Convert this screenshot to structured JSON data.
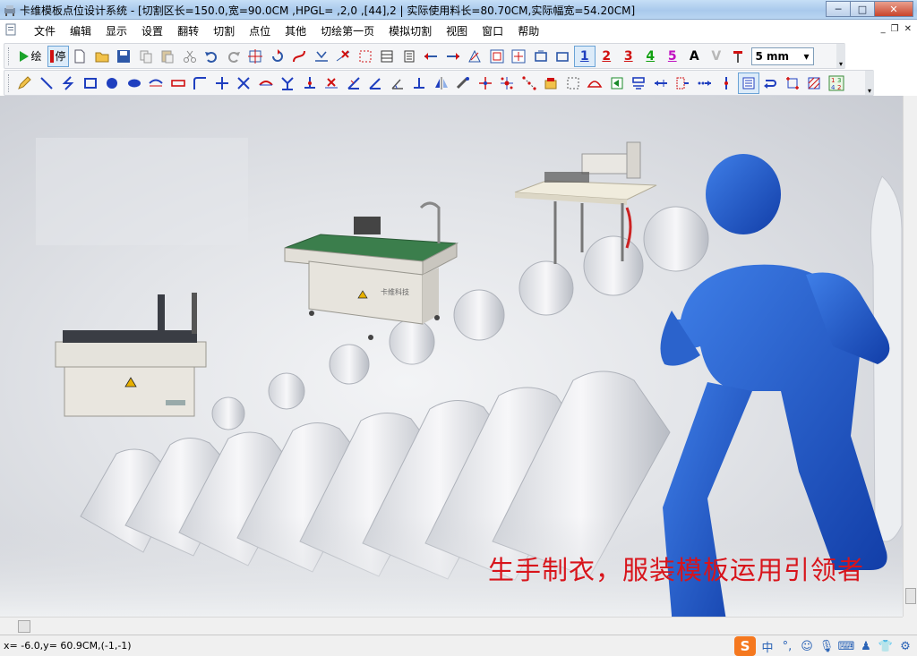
{
  "window": {
    "title": "卡维模板点位设计系统 - [切割区长=150.0,宽=90.0CM ,HPGL= ,2,0 ,[44],2 | 实际使用料长=80.70CM,实际幅宽=54.20CM]",
    "minimize": "─",
    "maximize": "□",
    "close": "✕"
  },
  "menu": {
    "items": [
      "文件",
      "编辑",
      "显示",
      "设置",
      "翻转",
      "切割",
      "点位",
      "其他",
      "切绘第一页",
      "模拟切割",
      "视图",
      "窗口",
      "帮助"
    ],
    "mdi_minimize": "_",
    "mdi_restore": "❐",
    "mdi_close": "✕"
  },
  "toolbar1": {
    "draw_label": "绘",
    "stop_label": "停",
    "layer_labels": [
      "1",
      "2",
      "3",
      "4",
      "5"
    ],
    "layer_colors": [
      "#1f3fbf",
      "#d01010",
      "#d01010",
      "#10a010",
      "#c010c0"
    ],
    "text_tool": "A",
    "v_tool": "V",
    "unit_select": "5 mm"
  },
  "toolbar2": {
    "grid_label_top": "1 3",
    "grid_label_bottom": "4 2"
  },
  "canvas": {
    "slogan": "生手制衣，服装模板运用引领者",
    "machine_brand": "卡维科技"
  },
  "status": {
    "coordinates": "x= -6.0,y= 60.9CM,(-1,-1)"
  },
  "ime": {
    "logo": "S",
    "mode": "中",
    "punct": "°,"
  }
}
